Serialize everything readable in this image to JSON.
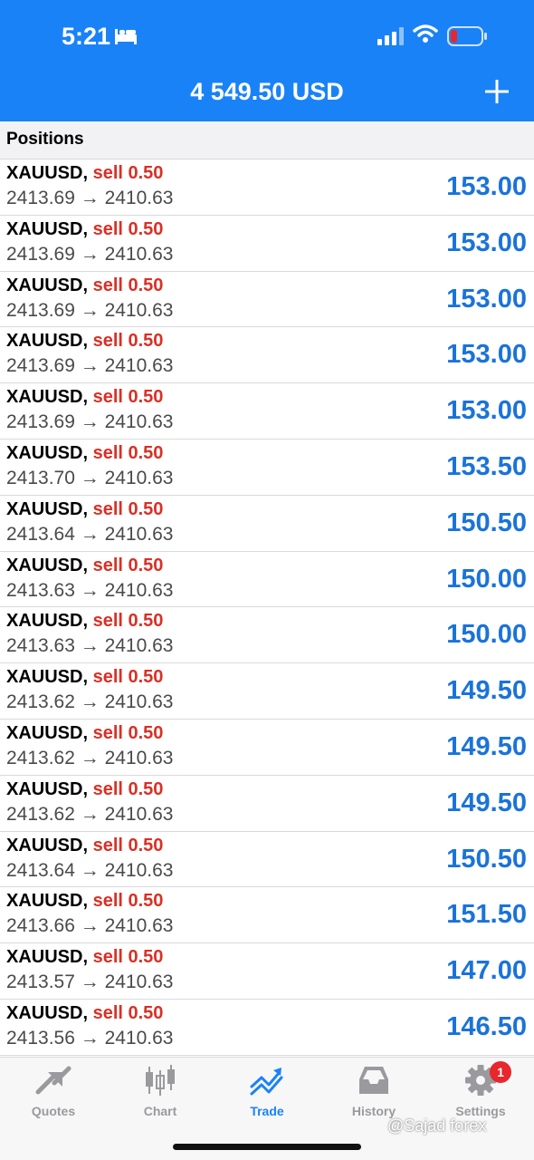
{
  "status": {
    "time": "5:21"
  },
  "header": {
    "balance": "4 549.50 USD"
  },
  "section": {
    "title": "Positions"
  },
  "positions": [
    {
      "symbol": "XAUUSD,",
      "side": "sell 0.50",
      "prices": "2413.69 → 2410.63",
      "profit": "153.00"
    },
    {
      "symbol": "XAUUSD,",
      "side": "sell 0.50",
      "prices": "2413.69 → 2410.63",
      "profit": "153.00"
    },
    {
      "symbol": "XAUUSD,",
      "side": "sell 0.50",
      "prices": "2413.69 → 2410.63",
      "profit": "153.00"
    },
    {
      "symbol": "XAUUSD,",
      "side": "sell 0.50",
      "prices": "2413.69 → 2410.63",
      "profit": "153.00"
    },
    {
      "symbol": "XAUUSD,",
      "side": "sell 0.50",
      "prices": "2413.69 → 2410.63",
      "profit": "153.00"
    },
    {
      "symbol": "XAUUSD,",
      "side": "sell 0.50",
      "prices": "2413.70 → 2410.63",
      "profit": "153.50"
    },
    {
      "symbol": "XAUUSD,",
      "side": "sell 0.50",
      "prices": "2413.64 → 2410.63",
      "profit": "150.50"
    },
    {
      "symbol": "XAUUSD,",
      "side": "sell 0.50",
      "prices": "2413.63 → 2410.63",
      "profit": "150.00"
    },
    {
      "symbol": "XAUUSD,",
      "side": "sell 0.50",
      "prices": "2413.63 → 2410.63",
      "profit": "150.00"
    },
    {
      "symbol": "XAUUSD,",
      "side": "sell 0.50",
      "prices": "2413.62 → 2410.63",
      "profit": "149.50"
    },
    {
      "symbol": "XAUUSD,",
      "side": "sell 0.50",
      "prices": "2413.62 → 2410.63",
      "profit": "149.50"
    },
    {
      "symbol": "XAUUSD,",
      "side": "sell 0.50",
      "prices": "2413.62 → 2410.63",
      "profit": "149.50"
    },
    {
      "symbol": "XAUUSD,",
      "side": "sell 0.50",
      "prices": "2413.64 → 2410.63",
      "profit": "150.50"
    },
    {
      "symbol": "XAUUSD,",
      "side": "sell 0.50",
      "prices": "2413.66 → 2410.63",
      "profit": "151.50"
    },
    {
      "symbol": "XAUUSD,",
      "side": "sell 0.50",
      "prices": "2413.57 → 2410.63",
      "profit": "147.00"
    },
    {
      "symbol": "XAUUSD,",
      "side": "sell 0.50",
      "prices": "2413.56 → 2410.63",
      "profit": "146.50"
    }
  ],
  "tabs": [
    {
      "label": "Quotes",
      "icon": "quotes-icon",
      "active": false
    },
    {
      "label": "Chart",
      "icon": "chart-icon",
      "active": false
    },
    {
      "label": "Trade",
      "icon": "trade-icon",
      "active": true
    },
    {
      "label": "History",
      "icon": "history-icon",
      "active": false
    },
    {
      "label": "Settings",
      "icon": "settings-icon",
      "active": false,
      "badge": "1"
    }
  ],
  "watermark": "@Sajad forex",
  "colors": {
    "accent": "#1a82f7",
    "sell": "#d93025",
    "profit": "#1a73d9"
  }
}
